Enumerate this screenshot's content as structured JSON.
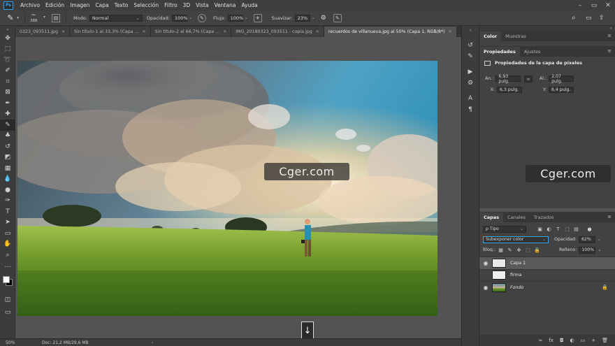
{
  "menubar": {
    "logo": "Ps",
    "items": [
      "Archivo",
      "Edición",
      "Imagen",
      "Capa",
      "Texto",
      "Selección",
      "Filtro",
      "3D",
      "Vista",
      "Ventana",
      "Ayuda"
    ],
    "window_controls": [
      "–",
      "▭",
      "✕"
    ]
  },
  "options": {
    "brush_size": "388",
    "mode_label": "Modo:",
    "mode_value": "Normal",
    "opacity_label": "Opacidad:",
    "opacity_value": "100%",
    "flow_label": "Flujo:",
    "flow_value": "100%",
    "smoothing_label": "Suavizar:",
    "smoothing_value": "23%"
  },
  "tabs": [
    {
      "label": "0323_093511.jpg",
      "active": false
    },
    {
      "label": "Sin título-1 al 33,3% (Capa ...",
      "active": false
    },
    {
      "label": "Sin título-2 al 66,7% (Capa ...",
      "active": false
    },
    {
      "label": "IMG_20180323_093511 - copia.jpg",
      "active": false
    },
    {
      "label": "recuerdos de villanueva.jpg al 50% (Capa 1, RGB/8*)",
      "active": true
    }
  ],
  "tab_overflow": "»",
  "watermark": "Cger.com",
  "status": {
    "zoom": "50%",
    "doc": "Doc: 21,2 MB/29,6 MB"
  },
  "color_panel": {
    "tabs": [
      "Color",
      "Muestras"
    ]
  },
  "properties_panel": {
    "tabs": [
      "Propiedades",
      "Ajustes"
    ],
    "title": "Propiedades de la capa de píxeles",
    "w_label": "An.:",
    "w_value": "6,93 pulg.",
    "h_label": "Al.:",
    "h_value": "2,07 pulg.",
    "x_label": "X:",
    "x_value": "6,3 pulg.",
    "y_label": "Y:",
    "y_value": "6,4 pulg."
  },
  "layers_panel": {
    "tabs": [
      "Capas",
      "Canales",
      "Trazados"
    ],
    "filter_value": "ρ Tipo",
    "blend_mode": "Subexponer color",
    "opacity_label": "Opacidad:",
    "opacity_value": "62%",
    "lock_label": "Bloq.:",
    "fill_label": "Relleno:",
    "fill_value": "100%",
    "layers": [
      {
        "name": "Capa 1",
        "selected": true,
        "visible": true,
        "italic": false
      },
      {
        "name": "firma",
        "selected": false,
        "visible": false,
        "italic": false
      },
      {
        "name": "Fondo",
        "selected": false,
        "visible": true,
        "italic": true
      }
    ],
    "bottom_icons": [
      "∞",
      "fx",
      "◘",
      "◐",
      "▭",
      "+",
      "🗑"
    ]
  },
  "colors": {
    "accent": "#31a8ff",
    "panel_bg": "#424242",
    "workspace": "#535353"
  }
}
